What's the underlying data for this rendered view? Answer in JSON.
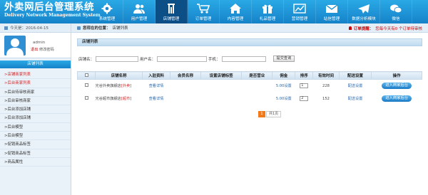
{
  "app": {
    "title": "外卖网后台管理系统",
    "subtitle": "Delivery Network Management System"
  },
  "nav": [
    {
      "label": "系统管理",
      "icon": "gear-icon"
    },
    {
      "label": "用户管理",
      "icon": "users-icon"
    },
    {
      "label": "店铺管理",
      "icon": "store-icon",
      "active": true
    },
    {
      "label": "订单管理",
      "icon": "cart-icon"
    },
    {
      "label": "内容管理",
      "icon": "home-icon"
    },
    {
      "label": "礼品管理",
      "icon": "gift-icon"
    },
    {
      "label": "营销管理",
      "icon": "chart-icon"
    },
    {
      "label": "站信管理",
      "icon": "mail-icon"
    },
    {
      "label": "数据分析模块",
      "icon": "plane-icon"
    },
    {
      "label": "微信",
      "icon": "wechat-icon"
    }
  ],
  "subbar": {
    "date": "今天是：2016-04-15",
    "location_prefix": "您现在的位置：",
    "location": "店铺列表",
    "notice_prefix": "订单提醒：",
    "notice": "您每今天有0 个订单待审核"
  },
  "user": {
    "name": "admin",
    "logout": "退出",
    "change_pwd": "修改密码"
  },
  "sidebar": {
    "header": "店铺列表",
    "items": [
      {
        "label": ">店铺商家列表",
        "red": true
      },
      {
        "label": ">后台商家列表",
        "red": true
      },
      {
        "label": ">后台待审核商家",
        "red": false
      },
      {
        "label": ">后台审核商家",
        "red": false
      },
      {
        "label": ">后台添加店铺",
        "red": false
      },
      {
        "label": ">后台添加店铺",
        "red": false
      },
      {
        "label": ">后台模型",
        "red": false
      },
      {
        "label": ">后台模型",
        "red": false
      },
      {
        "label": ">促销商品标签",
        "red": false
      },
      {
        "label": ">促销商品标签",
        "red": false
      },
      {
        "label": ">商品属性",
        "red": false
      }
    ]
  },
  "panel": {
    "title": "店铺列表"
  },
  "search": {
    "shop_label": "店铺名：",
    "user_label": "用户名：",
    "phone_label": "手机：",
    "button": "提交查询"
  },
  "table": {
    "headers": [
      "",
      "店铺名称",
      "入驻资料",
      "会员名称",
      "设置店铺标签",
      "是否营业",
      "佣金",
      "排序",
      "有效时间",
      "配送设置",
      "操作"
    ],
    "rows": [
      {
        "name": "光谷外卖旗舰店",
        "tag": "[外卖]",
        "info": "查看详情",
        "member": "",
        "label": "",
        "open": "",
        "commission": "5.00设置",
        "sort": "1",
        "valid": "228",
        "delivery": "配送设置",
        "action": "进入商家后台"
      },
      {
        "name": "光谷超市旗舰店",
        "tag": "[超市]",
        "info": "查看详情",
        "member": "",
        "label": "",
        "open": "",
        "commission": "5.00设置",
        "sort": "2",
        "valid": "152",
        "delivery": "配送设置",
        "action": "进入商家后台"
      }
    ]
  },
  "pager": {
    "current": "1",
    "total": "共1页"
  },
  "colors": {
    "header": "#1a8bd2",
    "active_nav": "#0c4f86",
    "accent_orange": "#f07b1c",
    "notice_red": "#cc0000"
  }
}
